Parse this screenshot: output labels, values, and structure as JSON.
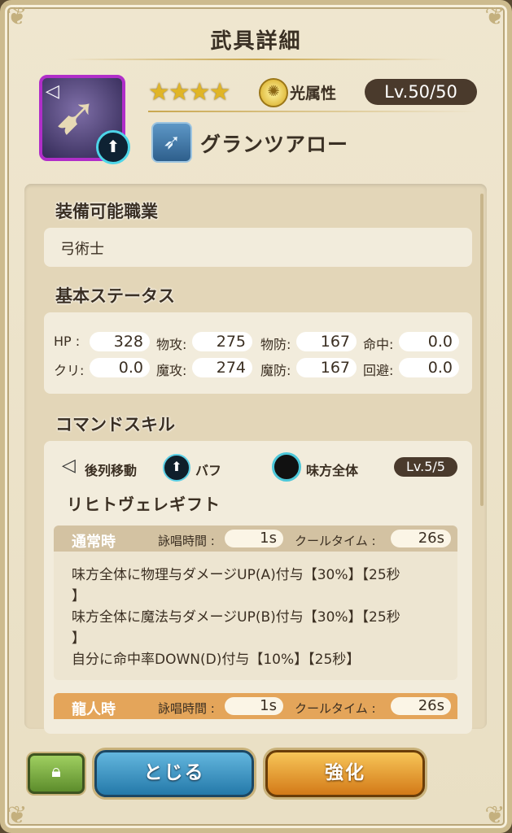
{
  "header": {
    "title": "武具詳細"
  },
  "weapon": {
    "stars": "★★★★",
    "attribute_label": "光属性",
    "level": "Lv.50/50",
    "name": "グランツアロー"
  },
  "sections": {
    "equip_jobs": {
      "heading": "装備可能職業",
      "value": "弓術士"
    },
    "base_stats": {
      "heading": "基本ステータス",
      "rows": [
        [
          {
            "label": "HP :",
            "value": "328"
          },
          {
            "label": "物攻:",
            "value": "275"
          },
          {
            "label": "物防:",
            "value": "167"
          },
          {
            "label": "命中:",
            "value": "0.0"
          }
        ],
        [
          {
            "label": "クリ:",
            "value": "0.0"
          },
          {
            "label": "魔攻:",
            "value": "274"
          },
          {
            "label": "魔防:",
            "value": "167"
          },
          {
            "label": "回避:",
            "value": "0.0"
          }
        ]
      ]
    },
    "command_skill": {
      "heading": "コマンドスキル",
      "tags": {
        "move": "後列移動",
        "buff": "バフ",
        "target": "味方全体"
      },
      "level": "Lv.5/5",
      "name": "リヒトヴェレギフト",
      "normal": {
        "title": "通常時",
        "cast_label": "詠唱時間 :",
        "cast_value": "1s",
        "cooldown_label": "クールタイム :",
        "cooldown_value": "26s",
        "effects": [
          "味方全体に物理与ダメージUP(A)付与【30%】【25秒",
          "】",
          "味方全体に魔法与ダメージUP(B)付与【30%】【25秒",
          "】",
          "自分に命中率DOWN(D)付与【10%】【25秒】"
        ]
      },
      "dragon": {
        "title": "龍人時",
        "cast_label": "詠唱時間 :",
        "cast_value": "1s",
        "cooldown_label": "クールタイム :",
        "cooldown_value": "26s"
      }
    }
  },
  "footer": {
    "close_label": "とじる",
    "enhance_label": "強化"
  }
}
